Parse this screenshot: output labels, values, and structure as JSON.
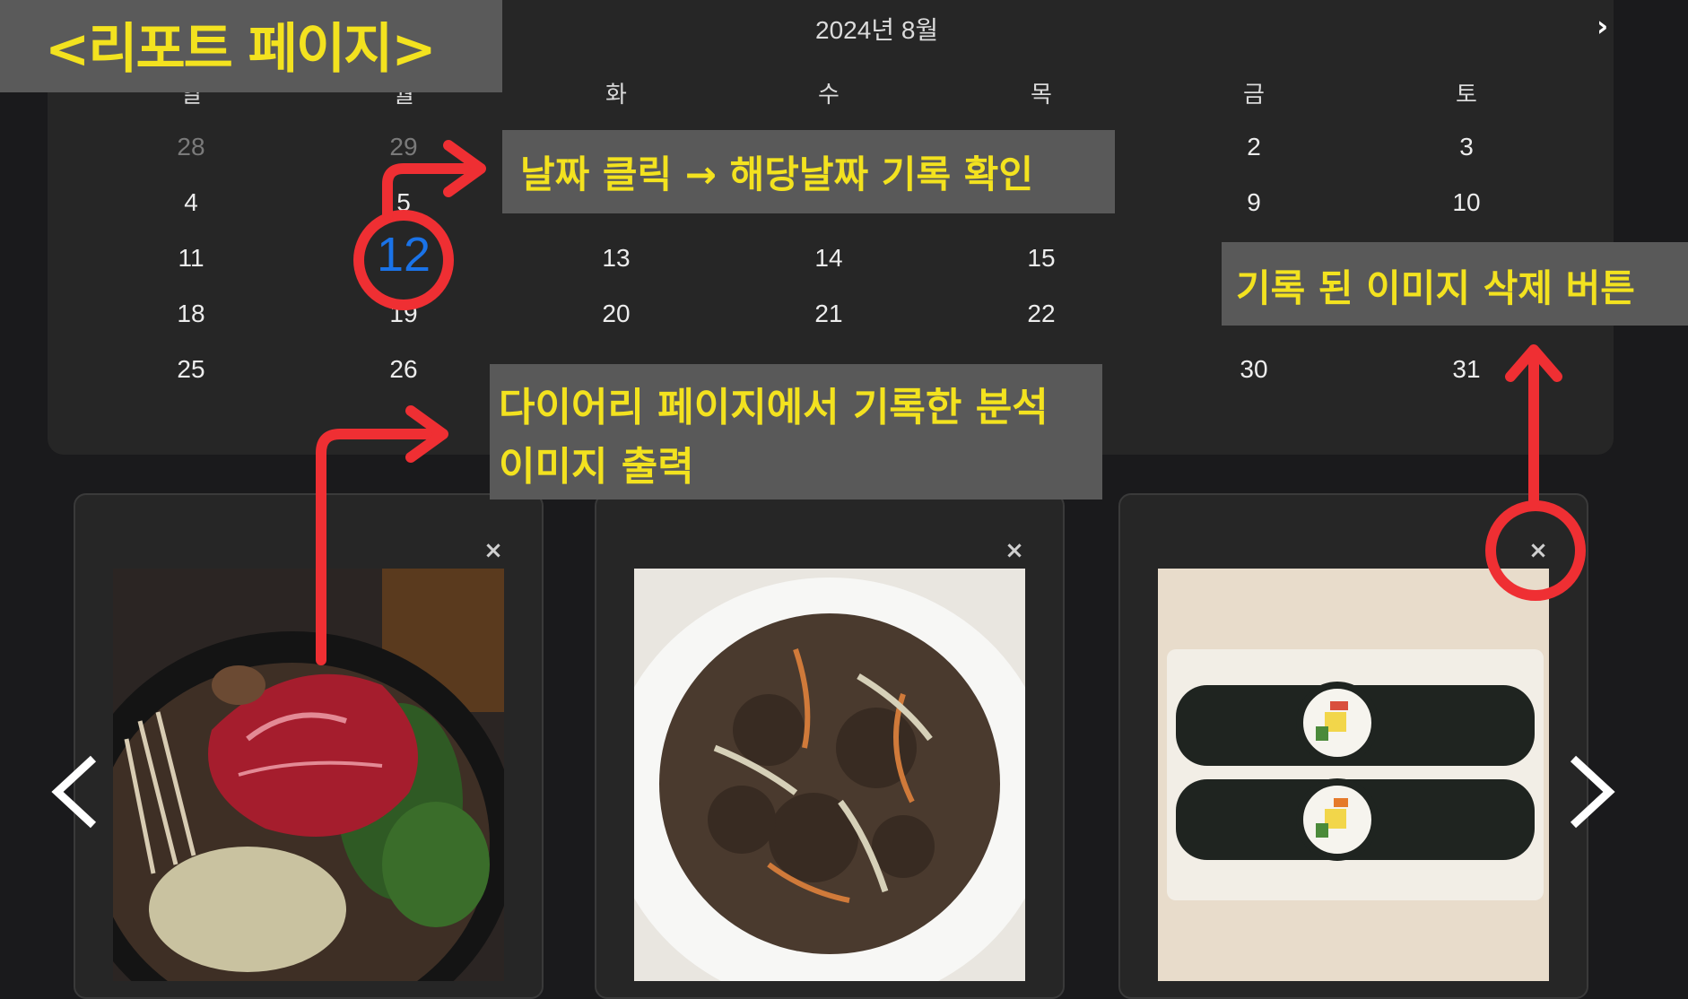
{
  "page_title": "<리포트 페이지>",
  "calendar": {
    "month_title": "2024년 8월",
    "next_icon": "›",
    "weekdays": [
      "일",
      "월",
      "화",
      "수",
      "목",
      "금",
      "토"
    ],
    "weeks": [
      [
        "28",
        "29",
        "",
        "",
        "",
        "2",
        "3"
      ],
      [
        "4",
        "5",
        "",
        "",
        "",
        "9",
        "10"
      ],
      [
        "11",
        "12",
        "13",
        "14",
        "15",
        "",
        ""
      ],
      [
        "18",
        "19",
        "20",
        "21",
        "22",
        "",
        ""
      ],
      [
        "25",
        "26",
        "",
        "",
        "",
        "30",
        "31"
      ]
    ],
    "selected_day": "12"
  },
  "annotations": {
    "date_click": "날짜 클릭 → 해당날짜 기록 확인",
    "delete_button": "기록 된 이미지 삭제 버튼",
    "diary_line1": "다이어리 페이지에서 기록한 분석",
    "diary_line2": "이미지 출력"
  },
  "cards": [
    {
      "close": "×",
      "image": "sukiyaki-photo"
    },
    {
      "close": "×",
      "image": "bulgogi-photo"
    },
    {
      "close": "×",
      "image": "kimbap-photo"
    }
  ],
  "nav": {
    "prev": "chevron-left-icon",
    "next": "chevron-right-icon"
  },
  "colors": {
    "highlight": "#f3e21f",
    "annotation_red": "#ef2f33",
    "selected_date": "#1a73e8"
  }
}
